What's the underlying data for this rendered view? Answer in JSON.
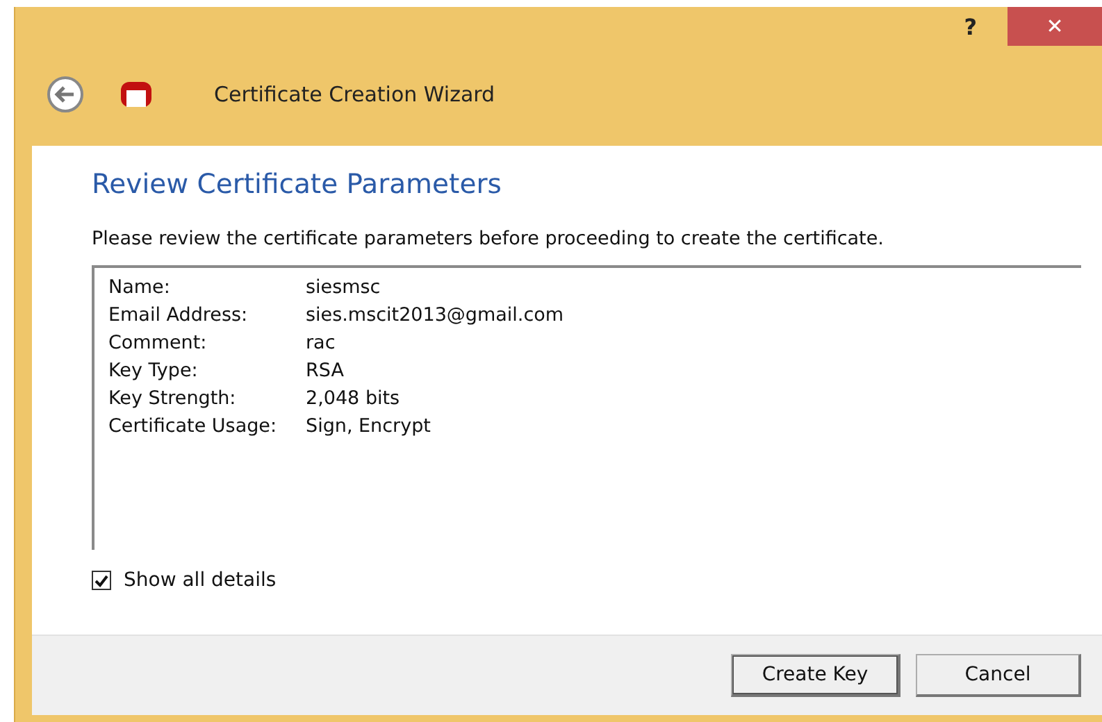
{
  "window": {
    "title": "Certificate Creation Wizard",
    "help": "?",
    "close": "✕"
  },
  "page": {
    "heading": "Review Certificate Parameters",
    "description": "Please review the certificate parameters before proceeding to create the certificate."
  },
  "details": [
    {
      "label": "Name:",
      "value": "siesmsc"
    },
    {
      "label": "Email Address:",
      "value": "sies.mscit2013@gmail.com"
    },
    {
      "label": "Comment:",
      "value": "rac"
    },
    {
      "label": "Key Type:",
      "value": "RSA"
    },
    {
      "label": "Key Strength:",
      "value": "2,048 bits"
    },
    {
      "label": "Certificate Usage:",
      "value": "Sign, Encrypt"
    }
  ],
  "show_all_details": {
    "label": "Show all details",
    "checked": true
  },
  "buttons": [
    {
      "label": "Create Key",
      "default": true
    },
    {
      "label": "Cancel",
      "default": false
    }
  ]
}
